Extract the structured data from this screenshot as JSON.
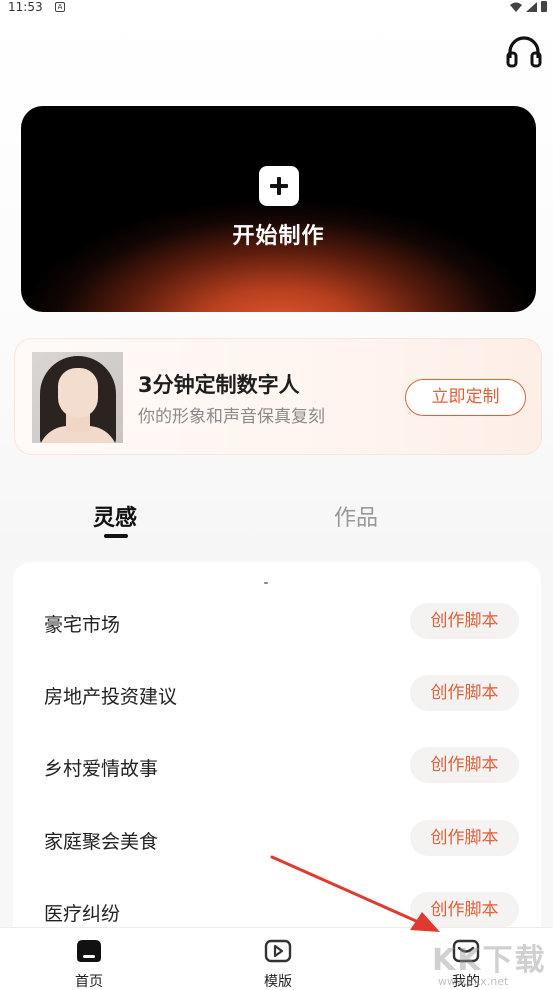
{
  "status_bar": {
    "time": "11:53",
    "notification_icon": "A"
  },
  "header": {
    "headset_icon": "headset-icon"
  },
  "hero": {
    "label": "开始制作"
  },
  "promo": {
    "title": "3分钟定制数字人",
    "subtitle": "你的形象和声音保真复刻",
    "button_label": "立即定制"
  },
  "tabs": [
    {
      "label": "灵感",
      "active": true
    },
    {
      "label": "作品",
      "active": false
    }
  ],
  "ideas": [
    {
      "title": "豪宅市场",
      "button": "创作脚本"
    },
    {
      "title": "房地产投资建议",
      "button": "创作脚本"
    },
    {
      "title": "乡村爱情故事",
      "button": "创作脚本"
    },
    {
      "title": "家庭聚会美食",
      "button": "创作脚本"
    },
    {
      "title": "医疗纠纷",
      "button": "创作脚本"
    }
  ],
  "bottom_nav": [
    {
      "label": "首页",
      "icon": "home-icon",
      "active": true
    },
    {
      "label": "模版",
      "icon": "video-template-icon",
      "active": false
    },
    {
      "label": "我的",
      "icon": "mine-icon",
      "active": false
    }
  ],
  "watermark": {
    "big": "KK下载",
    "small": "www.kkx.net"
  },
  "colors": {
    "accent": "#e0603a",
    "text": "#222222",
    "muted": "#8a8a8a"
  }
}
